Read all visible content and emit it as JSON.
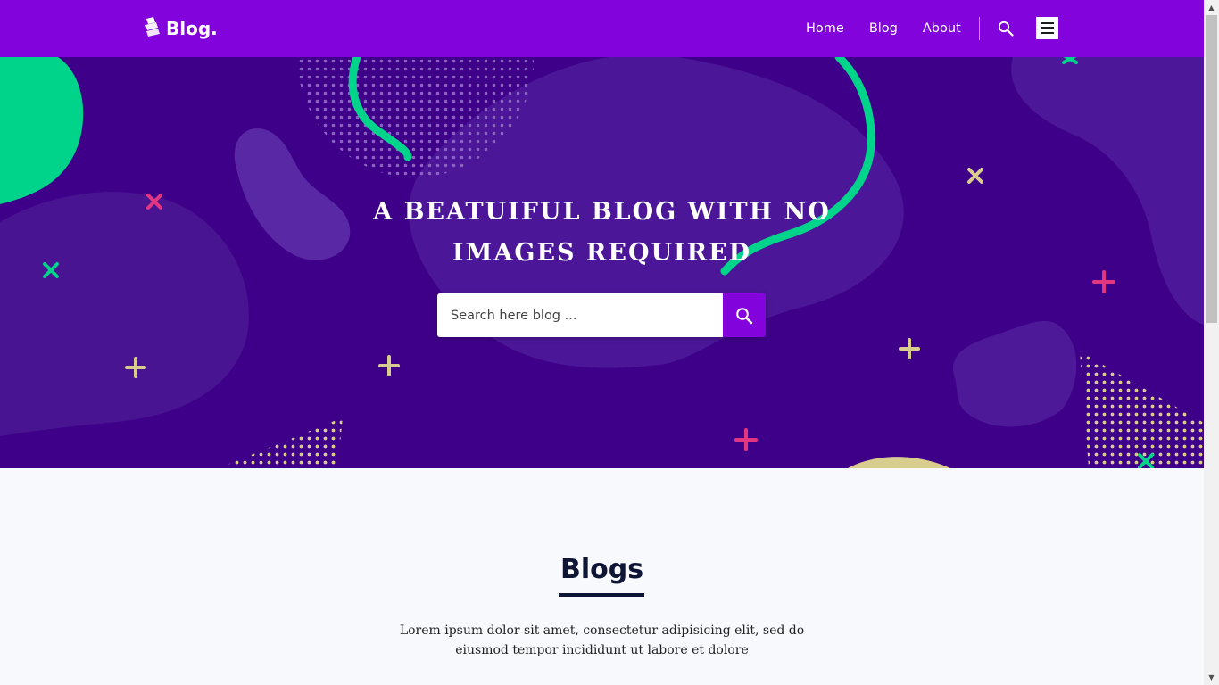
{
  "header": {
    "logo_text": "Blog.",
    "nav": [
      "Home",
      "Blog",
      "About"
    ]
  },
  "hero": {
    "title_line1": "A BEATUIFUL BLOG WITH NO",
    "title_line2": "IMAGES REQUIRED",
    "search_placeholder": "Search here blog ..."
  },
  "blogs": {
    "title": "Blogs",
    "description": "Lorem ipsum dolor sit amet, consectetur adipisicing elit, sed do eiusmod tempor incididunt ut labore et dolore"
  },
  "colors": {
    "header_bg": "#8203dc",
    "hero_bg": "#3f0089",
    "accent_green": "#00d38a",
    "accent_pink": "#e23681",
    "accent_cream": "#d8cd8e",
    "text_dark": "#0f1535"
  },
  "icons": {
    "logo": "logo-icon",
    "nav_search": "search-icon",
    "menu": "hamburger-menu-icon",
    "hero_search": "search-icon"
  }
}
